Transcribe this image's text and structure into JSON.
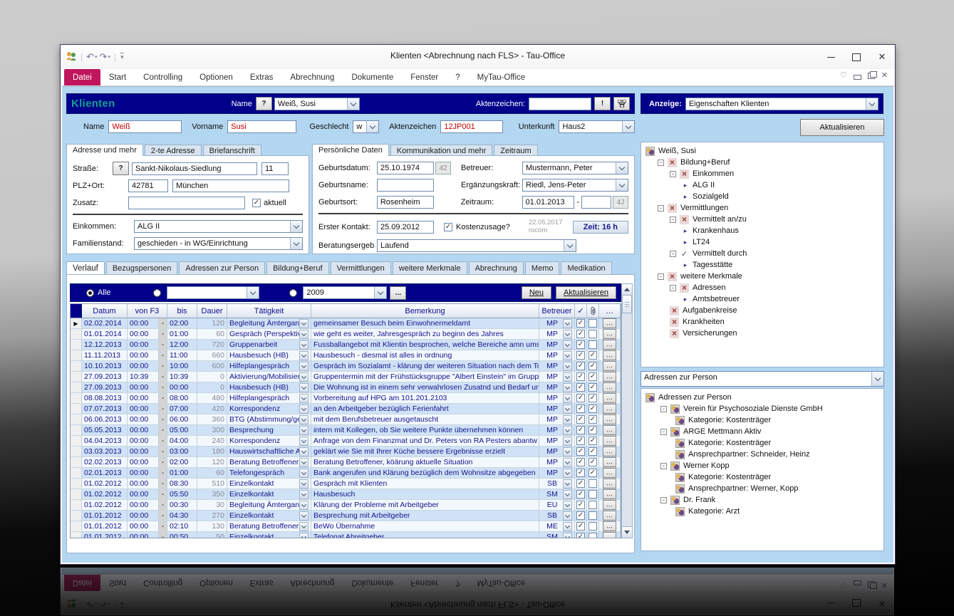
{
  "window": {
    "title": "Klienten <Abrechnung nach FLS>  -  Tau-Office",
    "menu": [
      "Datei",
      "Start",
      "Controlling",
      "Optionen",
      "Extras",
      "Abrechnung",
      "Dokumente",
      "Fenster",
      "?",
      "MyTau-Office"
    ],
    "active_menu": "Datei"
  },
  "header": {
    "module_title": "Klienten",
    "name_label": "Name",
    "help_button": "?",
    "name_value": "Weiß, Susi",
    "aktenzeichen_label": "Aktenzeichen:",
    "aktenzeichen_value": "",
    "warn_button": "!"
  },
  "anzeige": {
    "label": "Anzeige:",
    "value": "Eigenschaften Klienten",
    "refresh_button": "Aktualisieren"
  },
  "quick": {
    "name_label": "Name",
    "name": "Weiß",
    "vorname_label": "Vorname",
    "vorname": "Susi",
    "geschlecht_label": "Geschlecht",
    "geschlecht": "w",
    "aktenzeichen_label": "Aktenzeichen",
    "aktenzeichen": "12JP001",
    "unterkunft_label": "Unterkunft",
    "unterkunft": "Haus2"
  },
  "address": {
    "tabs": [
      "Adresse und mehr",
      "2-te Adresse",
      "Briefanschrift"
    ],
    "active_tab": "Adresse und mehr",
    "strasse_label": "Straße:",
    "lookup_button": "?",
    "strasse": "Sankt-Nikolaus-Siedlung",
    "hausnr": "11",
    "plz_label": "PLZ+Ort:",
    "plz": "42781",
    "ort": "München",
    "zusatz_label": "Zusatz:",
    "zusatz": "",
    "aktuell_label": "aktuell",
    "einkommen_label": "Einkommen:",
    "einkommen": "ALG II",
    "familienstand_label": "Familienstand:",
    "familienstand": "geschieden  -  in WG/Einrichtung"
  },
  "personal": {
    "tabs": [
      "Persönliche Daten",
      "Kommunikation und mehr",
      "Zeitraum"
    ],
    "active_tab": "Persönliche Daten",
    "geburtsdatum_label": "Geburtsdatum:",
    "geburtsdatum": "25.10.1974",
    "alter": "42",
    "betreuer_label": "Betreuer:",
    "betreuer": "Mustermann, Peter",
    "geburtsname_label": "Geburtsname:",
    "geburtsname": "",
    "ergaenzungskraft_label": "Ergänzungskraft:",
    "ergaenzungskraft": "Riedl, Jens-Peter",
    "geburtsort_label": "Geburtsort:",
    "geburtsort": "Rosenheim",
    "zeitraum_label": "Zeitraum:",
    "zeitraum_von": "01.01.2013",
    "zeitraum_bis": "",
    "zeitraum_dauer": "4J",
    "erster_kontakt_label": "Erster Kontakt:",
    "erster_kontakt": "25.09.2012",
    "kostenzusage_label": "Kostenzusage?",
    "stamp": "22.05.2017\nrocom",
    "zeit_button": "Zeit: 16 h",
    "beratungsergebnis_label": "Beratungsergeb\n:",
    "beratungsergebnis": "Laufend"
  },
  "main_tabs": {
    "items": [
      "Verlauf",
      "Bezugspersonen",
      "Adressen zur Person",
      "Bildung+Beruf",
      "Vermittlungen",
      "weitere Merkmale",
      "Abrechnung",
      "Memo",
      "Medikation"
    ],
    "active": "Verlauf"
  },
  "verlauf": {
    "filter": {
      "alle_label": "Alle",
      "filter2_value": "",
      "year_value": "2009",
      "more_button": "...",
      "neu_button": "Neu",
      "refresh_button": "Aktualisieren"
    },
    "table": {
      "columns": [
        "Datum",
        "von   F3",
        "bis",
        "Dauer",
        "Tätigkeit",
        "Bemerkung",
        "Betreuer"
      ],
      "rows": [
        [
          "02.02.2014",
          "00:00",
          "02:00",
          "120",
          "Begleitung Ämtergan",
          "gemeinsamer Besuch beim Einwohnermeldamt",
          "MP",
          true,
          false
        ],
        [
          "01.01.2014",
          "00:00",
          "01:00",
          "60",
          "Gespräch (Perspektiv",
          "wie geht es weiter, Jahresgespräch zu beginn des Jahres",
          "MP",
          true,
          false
        ],
        [
          "12.12.2013",
          "00:00",
          "12:00",
          "720",
          "Gruppenarbeit",
          "Fussballangebot mit Klientin besprochen, welche Bereiche amn umse",
          "MP",
          true,
          false
        ],
        [
          "11.11.2013",
          "00:00",
          "11:00",
          "660",
          "Hausbesuch (HB)",
          "Hausbesuch - diesmal ist alles in ordnung",
          "MP",
          true,
          true
        ],
        [
          "10.10.2013",
          "00:00",
          "10:00",
          "600",
          "Hilfeplangespräch",
          "Gespräch im Sozialamt - klärung der weiteren Situation nach dem To",
          "MP",
          true,
          true
        ],
        [
          "27.09.2013",
          "10:39",
          "10:39",
          "0",
          "Aktivierung/Mobilisier",
          "Gruppentermin mit der Frühstücksgruppe \"Albert Einstein\" im Gruppe",
          "MP",
          true,
          true
        ],
        [
          "27.09.2013",
          "00:00",
          "00:00",
          "0",
          "Hausbesuch (HB)",
          "Die Wohnung ist in einem sehr verwahrlosen Zusatnd und Bedarf un",
          "MP",
          true,
          true
        ],
        [
          "08.08.2013",
          "00:00",
          "08:00",
          "480",
          "Hilfeplangespräch",
          "Vorbereitung auf HPG am 101.201.2103",
          "MP",
          true,
          true
        ],
        [
          "07.07.2013",
          "00:00",
          "07:00",
          "420",
          "Korrespondenz",
          "an den Arbeitgeber bezüglich Ferienfahrt",
          "MP",
          true,
          true
        ],
        [
          "06.06.2013",
          "00:00",
          "06:00",
          "360",
          "BTG (Abstimmung/ge",
          "mit dem Berufsbetreuer ausgetauscht",
          "MP",
          true,
          true
        ],
        [
          "05.05.2013",
          "00:00",
          "05:00",
          "300",
          "Besprechung",
          "intern mit Kollegen, ob Sie weitere Punkte übernehmen können",
          "MP",
          true,
          true
        ],
        [
          "04.04.2013",
          "00:00",
          "04:00",
          "240",
          "Korrespondenz",
          "Anfrage von dem Finanzmat und Dr. Peters von RA Pesters abantw",
          "MP",
          true,
          true
        ],
        [
          "03.03.2013",
          "00:00",
          "03:00",
          "180",
          "Hauswirtschaftliche A",
          "geklärt wie Sie mit Ihrer Küche bessere Ergebnisse erzielt",
          "MP",
          true,
          true
        ],
        [
          "02.02.2013",
          "00:00",
          "02:00",
          "120",
          "Beratung Betroffener",
          "Beratung Betroffener, köärung aktuelle Situation",
          "MP",
          true,
          true
        ],
        [
          "02.01.2013",
          "00:00",
          "01:00",
          "60",
          "Telefongespräch",
          "Bank angerufen und Klärung bezüglich dem Wohnsitze abgegeben",
          "MP",
          true,
          true
        ],
        [
          "01.02.2012",
          "00:00",
          "08:30",
          "510",
          "Einzelkontakt",
          "Gespräch mit Klienten",
          "SB",
          true,
          false
        ],
        [
          "01.02.2012",
          "00:00",
          "05:50",
          "350",
          "Einzelkontakt",
          "Hausbesuch",
          "SM",
          true,
          false
        ],
        [
          "01.02.2012",
          "00:00",
          "00:30",
          "30",
          "Begleitung Ämtergan",
          "Klärung der Probleme mit Arbeitgeber",
          "EU",
          true,
          false
        ],
        [
          "01.01.2012",
          "00:00",
          "04:30",
          "270",
          "Einzelkontakt",
          "Besprechung mit Arbeitgeber",
          "SB",
          true,
          false
        ],
        [
          "01.01.2012",
          "00:00",
          "02:10",
          "130",
          "Beratung Betroffener",
          "BeWo Übernahme",
          "ME",
          true,
          false
        ],
        [
          "01.01.2012",
          "00:00",
          "00:50",
          "50",
          "Einzelkontakt",
          "Telefonat Abreitgeber",
          "SM",
          true,
          false
        ]
      ]
    }
  },
  "right": {
    "properties_tree": [
      {
        "lv": 0,
        "ic": "addr",
        "label": "Weiß, Susi"
      },
      {
        "lv": 1,
        "ex": true,
        "ic": "x",
        "label": "Bildung+Beruf"
      },
      {
        "lv": 2,
        "ex": true,
        "ic": "x",
        "label": "Einkommen"
      },
      {
        "lv": 3,
        "ic": "arrow",
        "label": "ALG II"
      },
      {
        "lv": 3,
        "ic": "arrow",
        "label": "Sozialgeld"
      },
      {
        "lv": 1,
        "ex": true,
        "ic": "x",
        "label": "Vermittlungen"
      },
      {
        "lv": 2,
        "ex": true,
        "ic": "x",
        "label": "Vermittelt an/zu"
      },
      {
        "lv": 3,
        "ic": "arrow",
        "label": "Krankenhaus"
      },
      {
        "lv": 3,
        "ic": "arrow",
        "label": "LT24"
      },
      {
        "lv": 2,
        "ex": true,
        "ic": "check",
        "label": "Vermittelt durch"
      },
      {
        "lv": 3,
        "ic": "arrow",
        "label": "Tagesstätte"
      },
      {
        "lv": 1,
        "ex": true,
        "ic": "x",
        "label": "weitere Merkmale"
      },
      {
        "lv": 2,
        "ex": true,
        "ic": "x",
        "label": "Adressen"
      },
      {
        "lv": 3,
        "ic": "arrow",
        "label": "Amtsbetreuer"
      },
      {
        "lv": 2,
        "ic": "x",
        "label": "Aufgabenkreise"
      },
      {
        "lv": 2,
        "ic": "x",
        "label": "Krankheiten"
      },
      {
        "lv": 2,
        "ic": "x",
        "label": "Versicherungen"
      }
    ],
    "addresses_combo": "Adressen zur Person",
    "addresses_tree": [
      {
        "lv": 0,
        "ic": "addr",
        "label": "Adressen zur Person"
      },
      {
        "lv": 1,
        "ex": true,
        "ic": "addr",
        "label": "Verein für Psychosoziale Dienste GmbH"
      },
      {
        "lv": 2,
        "ic": "addr",
        "label": "Kategorie: Kostenträger"
      },
      {
        "lv": 1,
        "ex": true,
        "ic": "addr",
        "label": "ARGE Mettmann Aktiv"
      },
      {
        "lv": 2,
        "ic": "addr",
        "label": "Kategorie: Kostenträger"
      },
      {
        "lv": 2,
        "ic": "addr",
        "label": "Ansprechpartner: Schneider, Heinz"
      },
      {
        "lv": 1,
        "ex": true,
        "ic": "addr",
        "label": "Werner Kopp"
      },
      {
        "lv": 2,
        "ic": "addr",
        "label": "Kategorie: Kostenträger"
      },
      {
        "lv": 2,
        "ic": "addr",
        "label": "Ansprechpartner: Werner, Kopp"
      },
      {
        "lv": 1,
        "ex": true,
        "ic": "addr",
        "label": "Dr. Frank"
      },
      {
        "lv": 2,
        "ic": "addr",
        "label": "Kategorie: Arzt"
      }
    ]
  }
}
